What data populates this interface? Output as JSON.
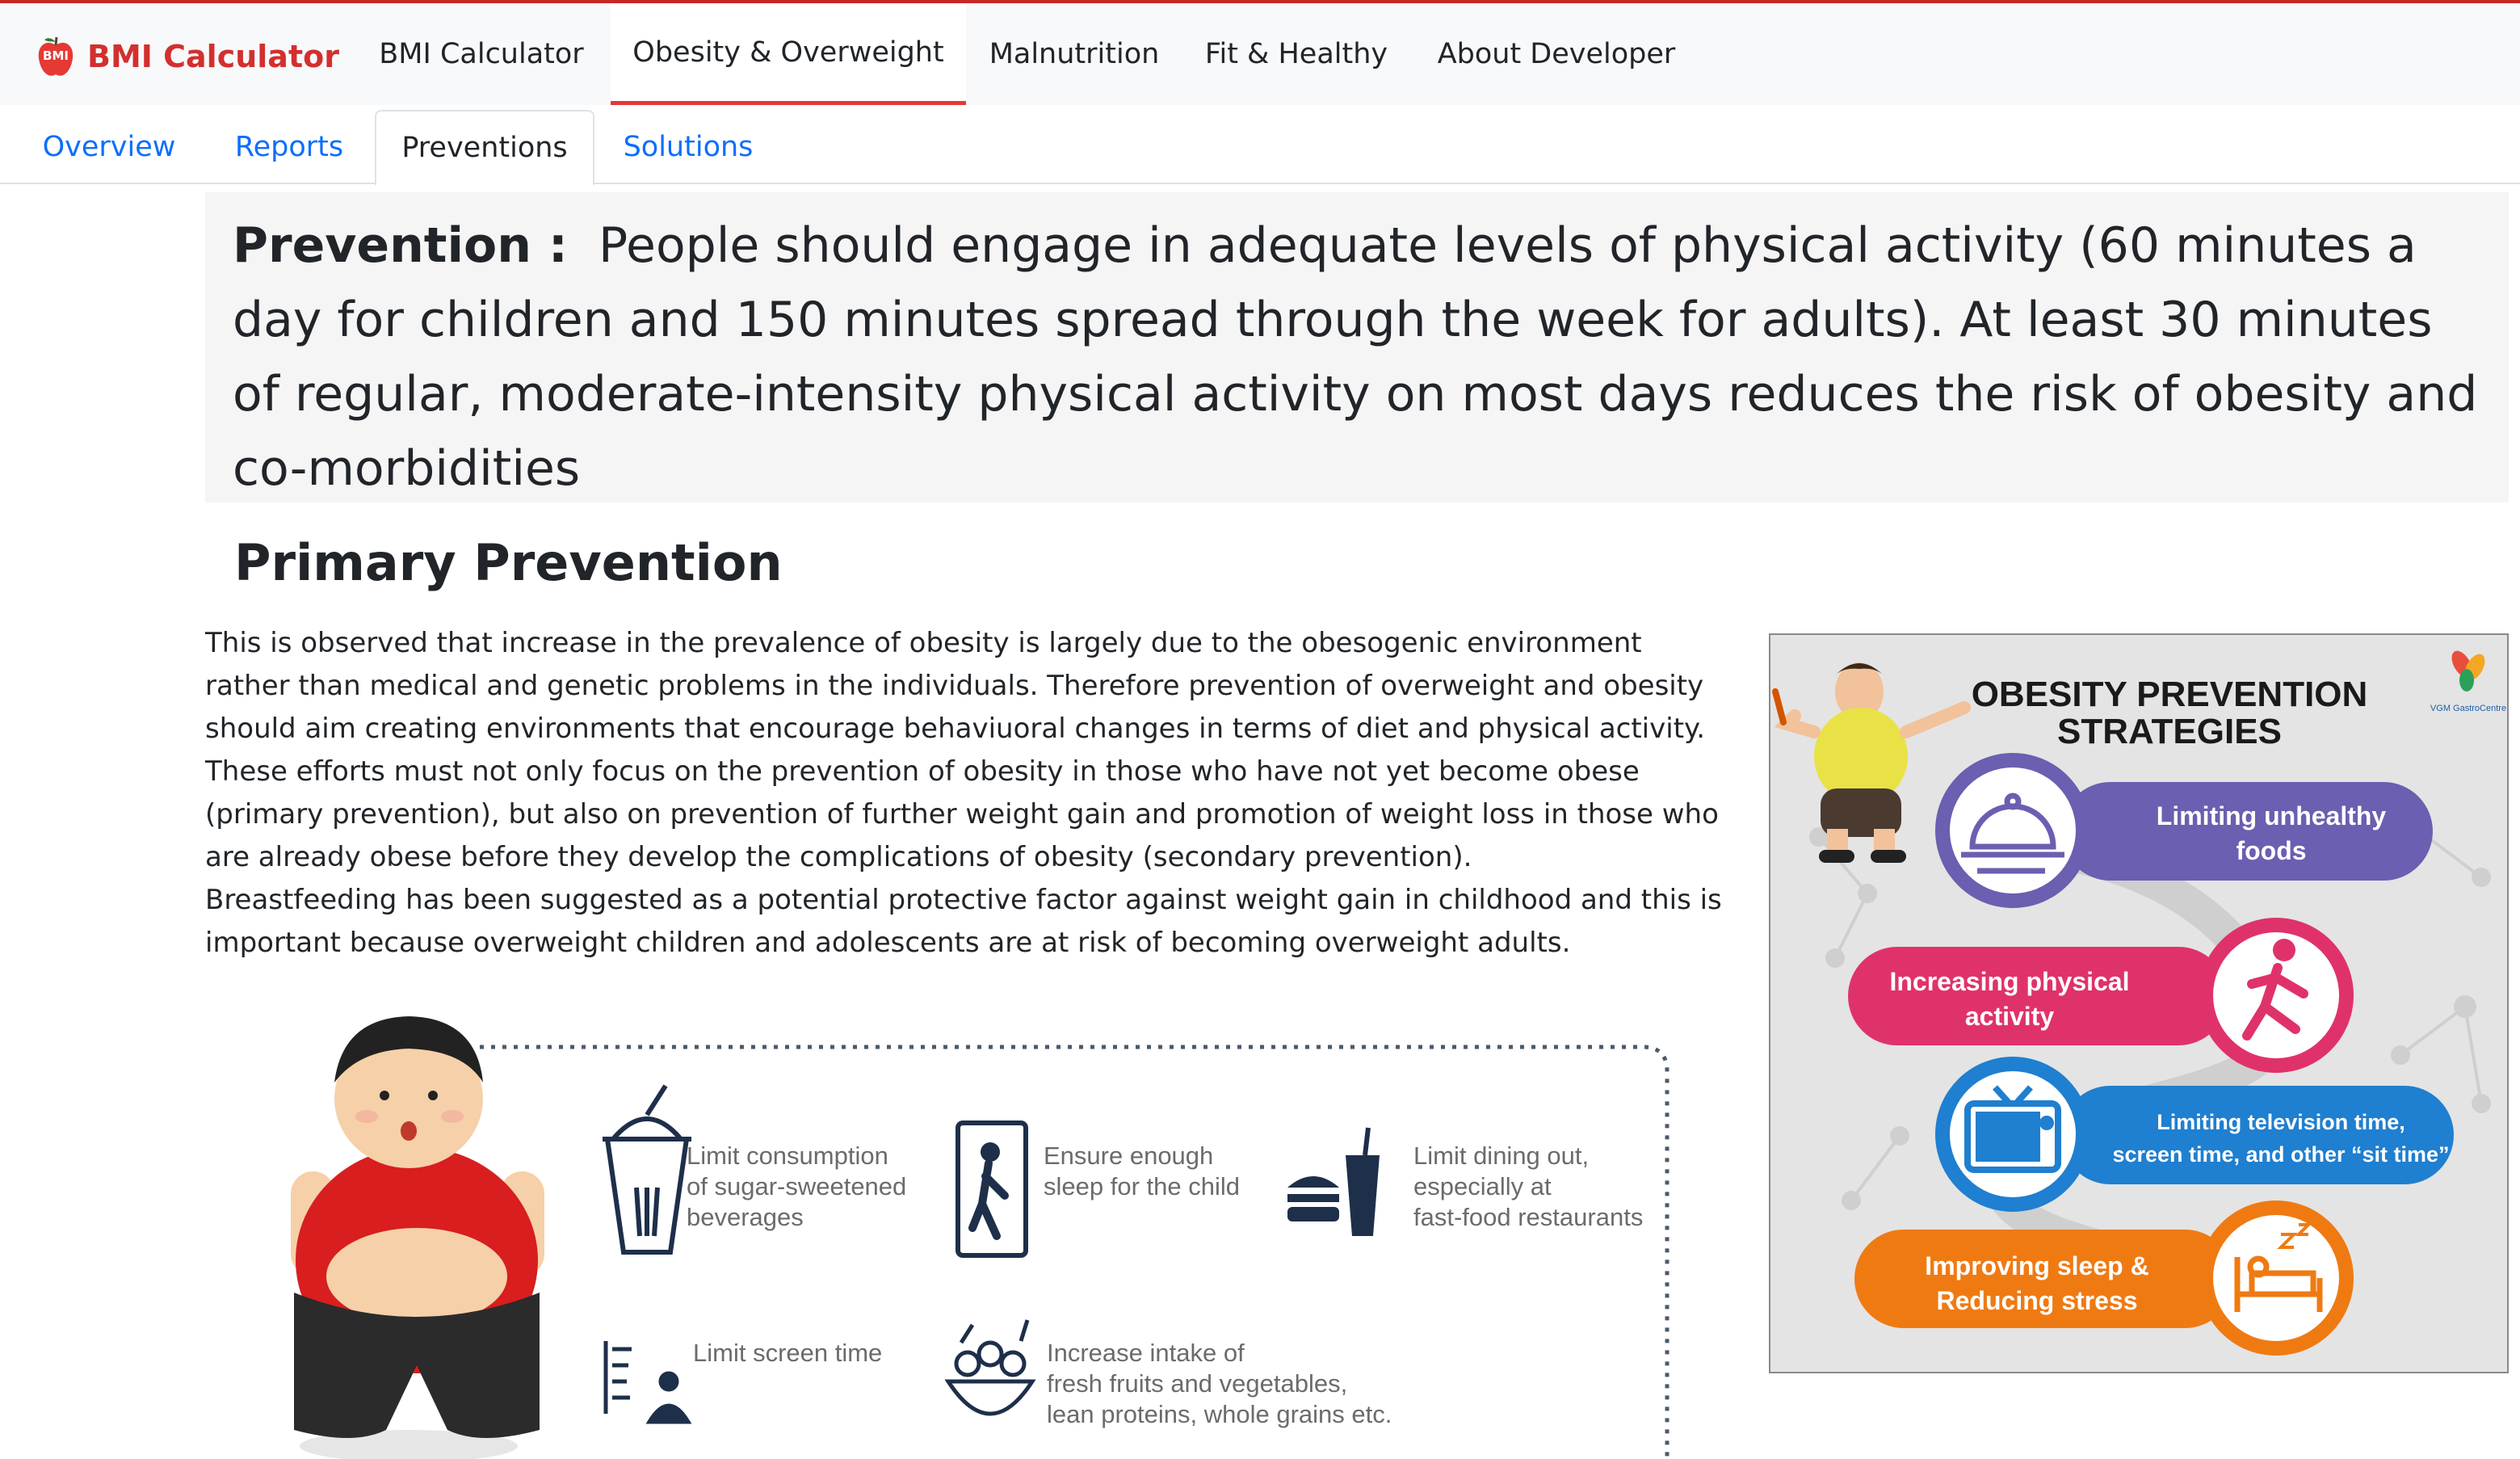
{
  "brand": {
    "name": "BMI Calculator",
    "logo_text": "BMI"
  },
  "nav": [
    {
      "label": "BMI Calculator"
    },
    {
      "label": "Obesity & Overweight"
    },
    {
      "label": "Malnutrition"
    },
    {
      "label": "Fit & Healthy"
    },
    {
      "label": "About Developer"
    }
  ],
  "subtabs": [
    {
      "label": "Overview"
    },
    {
      "label": "Reports"
    },
    {
      "label": "Preventions"
    },
    {
      "label": "Solutions"
    }
  ],
  "prevention": {
    "label": "Prevention :",
    "text": "People should engage in adequate levels of physical activity (60 minutes a day for children and 150 minutes spread through the week for adults). At least 30 minutes of regular, moderate-intensity physical activity on most days reduces the risk of obesity and co-morbidities"
  },
  "primary": {
    "heading": "Primary Prevention",
    "paragraphs": [
      "This is observed that increase in the prevalence of obesity is largely due to the obesogenic environment rather than medical and genetic problems in the individuals. Therefore prevention of overweight and obesity should aim creating environments that encourage behaviuoral changes in terms of diet and physical activity.",
      "These efforts must not only focus on the prevention of obesity in those who have not yet become obese (primary prevention), but also on prevention of further weight gain and promotion of weight loss in those who are already obese before they develop the complications of obesity (secondary prevention).",
      "Breastfeeding has been suggested as a potential protective factor against weight gain in childhood and this is important because overweight children and adolescents are at risk of becoming overweight adults."
    ]
  },
  "strategies": {
    "title_line1": "OBESITY PREVENTION",
    "title_line2": "STRATEGIES",
    "logo_text": "VGM GastroCentre",
    "items": [
      {
        "line1": "Limiting unhealthy",
        "line2": "foods",
        "color": "#6a5fb0"
      },
      {
        "line1": "Increasing physical",
        "line2": "activity",
        "color": "#e0326a"
      },
      {
        "line1": "Limiting television time,",
        "line2": "screen time, and other “sit time”",
        "color": "#1f7fd0"
      },
      {
        "line1": "Improving sleep &",
        "line2": "Reducing stress",
        "color": "#f07a12"
      }
    ]
  },
  "child_tips": [
    {
      "lines": [
        "Limit consumption",
        "of sugar-sweetened",
        "beverages"
      ]
    },
    {
      "lines": [
        "Ensure enough",
        "sleep for the child"
      ]
    },
    {
      "lines": [
        "Limit dining out,",
        "especially at",
        "fast-food restaurants"
      ]
    },
    {
      "lines": [
        "Limit screen time"
      ]
    },
    {
      "lines": [
        "Increase intake of",
        "fresh fruits and vegetables,",
        "lean proteins, whole grains etc."
      ]
    }
  ]
}
